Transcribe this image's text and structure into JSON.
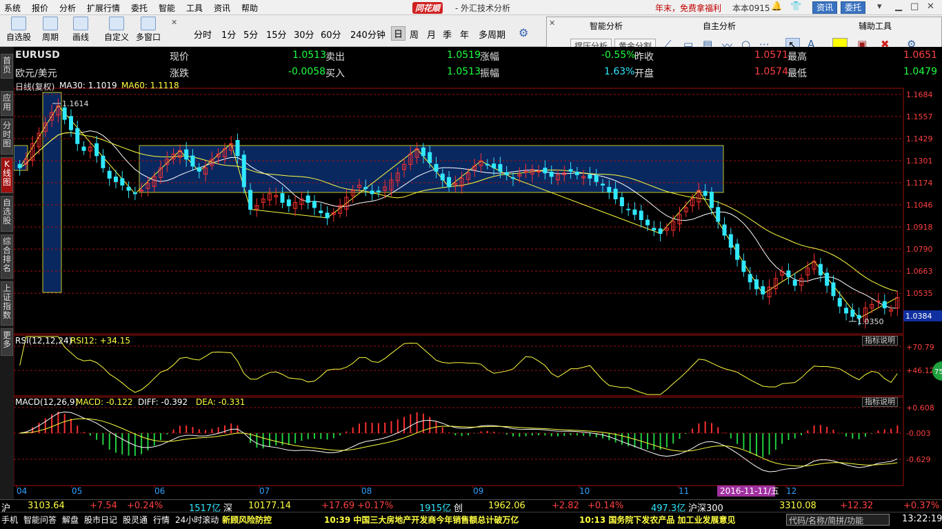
{
  "menu": [
    "系统",
    "报价",
    "分析",
    "扩展行情",
    "委托",
    "智能",
    "工具",
    "资讯",
    "帮助"
  ],
  "brand": "同花顺",
  "app_title": "- 外汇技术分析",
  "promo": "年末，免费拿福利",
  "version": "本本0915",
  "top_buttons": {
    "info": "资讯",
    "trade": "委托"
  },
  "toolbar": {
    "self_select": "自选股",
    "period": "周期",
    "draw": "画线",
    "custom": "自定义",
    "multi_window": "多窗口"
  },
  "periods": [
    "分时",
    "1分",
    "5分",
    "15分",
    "30分",
    "60分",
    "240分钟",
    "日",
    "周",
    "月",
    "季",
    "年",
    "多周期"
  ],
  "selected_period": "日",
  "panel": {
    "smart": "智能分析",
    "self_analysis": "自主分析",
    "aux": "辅助工具",
    "pressure": "撑压分析",
    "golden": "黄金分割"
  },
  "sidebar_tabs": [
    "首页",
    "应用",
    "分时图",
    "K线图",
    "自选股",
    "综合排名",
    "上证指数",
    "更多"
  ],
  "quote": {
    "symbol": "EURUSD",
    "name": "欧元/美元",
    "now_label": "现价",
    "now": "1.0513",
    "sell_label": "卖出",
    "sell": "1.0519",
    "change_pct_label": "涨幅",
    "change_pct": "-0.55%",
    "prev_label": "昨收",
    "prev": "1.0571",
    "high_label": "最高",
    "high": "1.0651",
    "change_label": "涨跌",
    "change": "-0.0058",
    "buy_label": "买入",
    "buy": "1.0513",
    "amp_label": "振幅",
    "amp": "1.63%",
    "open_label": "开盘",
    "open": "1.0574",
    "low_label": "最低",
    "low": "1.0479"
  },
  "indicators": {
    "main": "日线(复权)",
    "ma30": "MA30: 1.1019",
    "ma60": "MA60: 1.1118",
    "rsi": "RSI(12,12,24)",
    "rsi12": "RSI12: +34.15",
    "macd": "MACD(12,26,9)",
    "macd_val": "MACD: -0.122",
    "diff": "DIFF: -0.392",
    "dea": "DEA: -0.331",
    "explain": "指标说明"
  },
  "axis": {
    "price_ticks": [
      "1.1684",
      "1.1557",
      "1.1429",
      "1.1301",
      "1.1174",
      "1.1046",
      "1.0918",
      "1.0790",
      "1.0663",
      "1.0535",
      "1.0384"
    ],
    "rsi_ticks": [
      "+70.79",
      "+46.12"
    ],
    "macd_ticks": [
      "+0.608",
      "-0.003",
      "-0.629"
    ],
    "months": [
      "04",
      "05",
      "06",
      "07",
      "08",
      "09",
      "10",
      "11",
      "12"
    ],
    "date_cursor": "2016-11-11/五",
    "high_mark": "1.1614",
    "low_mark": "1.0350",
    "circle": "75"
  },
  "ticker": {
    "sh_label": "沪",
    "sh": "3103.64",
    "sh_chg": "+7.54",
    "sh_pct": "+0.24%",
    "sh_amt": "1517亿",
    "sz_label": "深",
    "sz": "10177.14",
    "sz_chg": "+17.69",
    "sz_pct": "+0.17%",
    "sz_amt": "1915亿",
    "cy_label": "创",
    "cy": "1962.06",
    "cy_chg": "+2.82",
    "cy_pct": "+0.14%",
    "cy_amt": "497.3亿",
    "hs_label": "沪深300",
    "hs": "3310.08",
    "hs_chg": "+12.32",
    "hs_pct": "+0.37%"
  },
  "status": {
    "items": [
      "手机",
      "智能问答",
      "解盘",
      "股市日记",
      "股灵通",
      "行情",
      "24小时滚动"
    ],
    "risk": "新顾风险防控",
    "news1": "10:39 中国三大房地产开发商今年销售额总计破万亿",
    "news2": "10:13 国务院下发农产品 加工业发展意见",
    "search_placeholder": "代码/名称/简拼/功能",
    "clock": "13:22:19"
  },
  "chart_data": {
    "type": "candlestick",
    "close": [
      1.126,
      1.131,
      1.14,
      1.146,
      1.152,
      1.158,
      1.162,
      1.154,
      1.148,
      1.14,
      1.136,
      1.138,
      1.133,
      1.126,
      1.12,
      1.118,
      1.116,
      1.113,
      1.111,
      1.113,
      1.117,
      1.121,
      1.126,
      1.131,
      1.134,
      1.136,
      1.131,
      1.127,
      1.124,
      1.126,
      1.131,
      1.134,
      1.137,
      1.14,
      1.133,
      1.115,
      1.102,
      1.104,
      1.108,
      1.111,
      1.11,
      1.106,
      1.104,
      1.106,
      1.108,
      1.106,
      1.103,
      1.1,
      1.097,
      1.1,
      1.104,
      1.109,
      1.113,
      1.116,
      1.114,
      1.111,
      1.112,
      1.115,
      1.119,
      1.123,
      1.128,
      1.134,
      1.137,
      1.133,
      1.129,
      1.124,
      1.119,
      1.115,
      1.117,
      1.12,
      1.123,
      1.127,
      1.13,
      1.128,
      1.126,
      1.124,
      1.122,
      1.12,
      1.122,
      1.124,
      1.125,
      1.124,
      1.123,
      1.121,
      1.122,
      1.123,
      1.124,
      1.122,
      1.121,
      1.12,
      1.118,
      1.116,
      1.112,
      1.108,
      1.104,
      1.102,
      1.099,
      1.096,
      1.093,
      1.09,
      1.088,
      1.091,
      1.095,
      1.099,
      1.103,
      1.108,
      1.113,
      1.11,
      1.103,
      1.095,
      1.087,
      1.08,
      1.073,
      1.066,
      1.06,
      1.056,
      1.053,
      1.057,
      1.062,
      1.066,
      1.063,
      1.058,
      1.062,
      1.068,
      1.072,
      1.064,
      1.058,
      1.052,
      1.046,
      1.042,
      1.04,
      1.039,
      1.045,
      1.047,
      1.049,
      1.045,
      1.044,
      1.051
    ],
    "ylim": [
      1.03,
      1.172
    ],
    "ma30_last": 1.1019,
    "ma60_last": 1.1118,
    "rsi_last": 34.15,
    "macd_last": -0.122,
    "diff_last": -0.392,
    "dea_last": -0.331
  }
}
